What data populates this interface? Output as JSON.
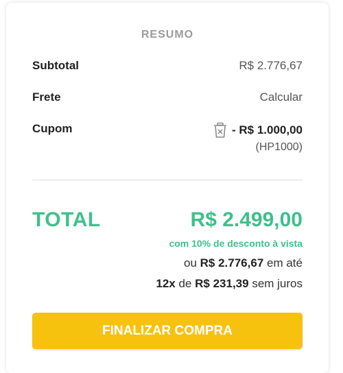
{
  "summary": {
    "title": "RESUMO",
    "subtotal_label": "Subtotal",
    "subtotal_value": "R$ 2.776,67",
    "shipping_label": "Frete",
    "shipping_value": "Calcular",
    "coupon_label": "Cupom",
    "coupon_icon": "trash-icon",
    "coupon_value": "- R$ 1.000,00",
    "coupon_code": "(HP1000)"
  },
  "total": {
    "label": "TOTAL",
    "value": "R$ 2.499,00",
    "discount_note": "com 10% de desconto à vista",
    "alt_prefix": "ou",
    "alt_value": "R$ 2.776,67",
    "alt_suffix": "em até",
    "installments_count": "12x",
    "installments_of": "de",
    "installments_value": "R$ 231,39",
    "installments_suffix": "sem juros"
  },
  "checkout_button": {
    "label": "FINALIZAR COMPRA"
  },
  "colors": {
    "accent_green": "#3ec08b",
    "button_yellow": "#f6c20e",
    "muted_title": "#9b9b9b"
  }
}
